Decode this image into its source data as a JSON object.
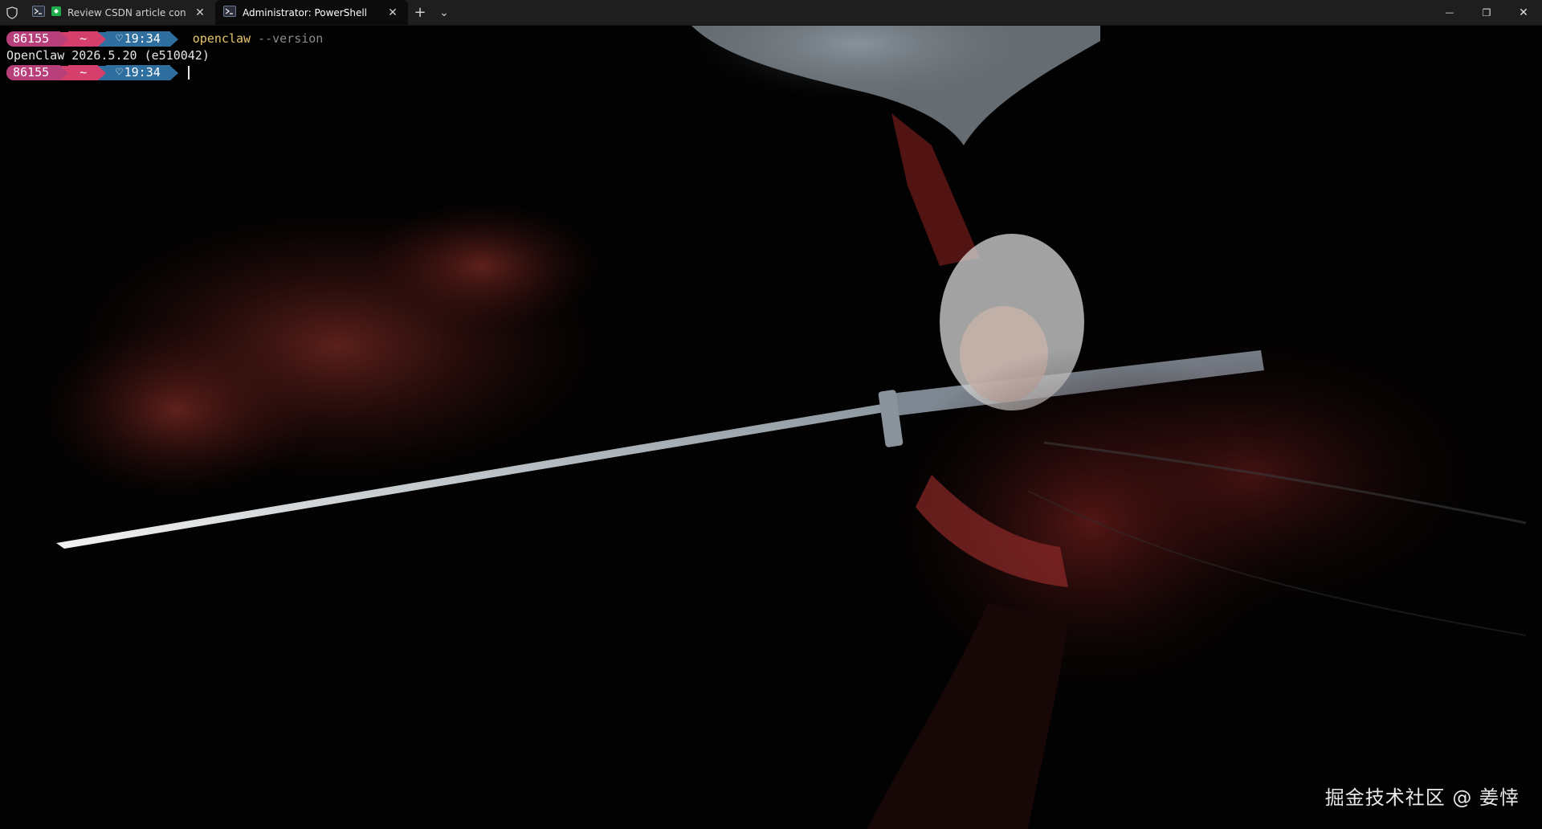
{
  "titlebar": {
    "tabs": [
      {
        "title": "Review CSDN article conte",
        "active": false,
        "icon": "powershell-icon"
      },
      {
        "title": "Administrator: PowerShell",
        "active": true,
        "icon": "powershell-icon"
      }
    ],
    "new_tab": "+",
    "dropdown": "⌄",
    "close_glyph": "✕",
    "window_controls": {
      "minimize": "—",
      "maximize": "❐",
      "close": "✕"
    }
  },
  "terminal": {
    "prompt": {
      "user": "86155",
      "path": "~",
      "time": "19:34",
      "heart": "♡"
    },
    "lines": [
      {
        "type": "prompt",
        "command": "openclaw",
        "args": " --version"
      },
      {
        "type": "output",
        "text": "OpenClaw 2026.5.20 (e510042)"
      },
      {
        "type": "prompt",
        "command": "",
        "args": ""
      }
    ]
  },
  "watermark": "掘金技术社区 @ 姜悻",
  "colors": {
    "prompt_user": "#b8407a",
    "prompt_path": "#d4406b",
    "prompt_time": "#2f6fa0",
    "command": "#e8c56a",
    "args": "#8a8a8a"
  }
}
